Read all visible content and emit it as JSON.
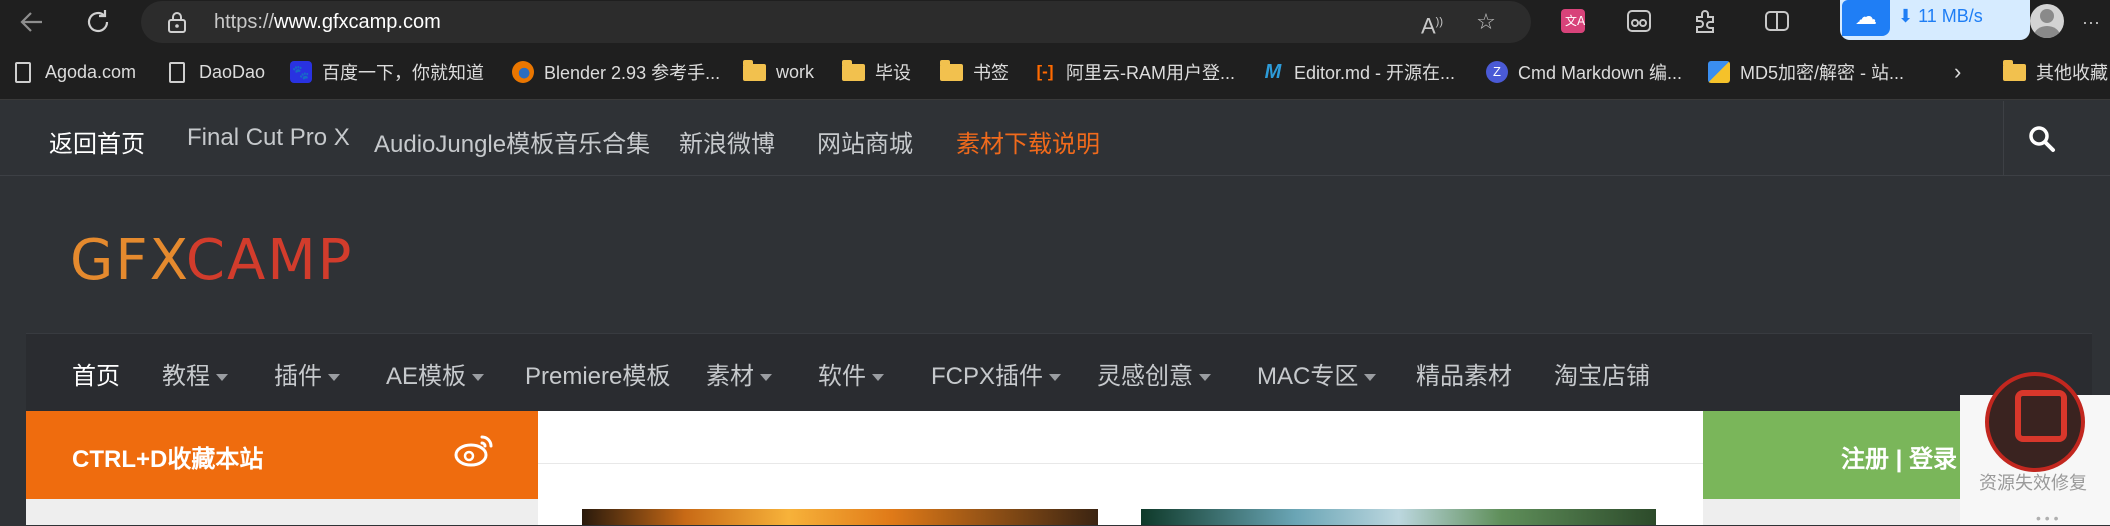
{
  "browser": {
    "url_prefix": "https://",
    "url_domain": "www.gfxcamp.com",
    "download_speed": "11 MB/s",
    "menu_glyph": "···"
  },
  "bookmarks": [
    {
      "label": "Agoda.com",
      "icon": "page-icon"
    },
    {
      "label": "DaoDao",
      "icon": "page-icon"
    },
    {
      "label": "百度一下，你就知道",
      "icon": "baidu-icon"
    },
    {
      "label": "Blender 2.93 参考手...",
      "icon": "blender-icon"
    },
    {
      "label": "work",
      "icon": "folder-icon"
    },
    {
      "label": "毕设",
      "icon": "folder-icon"
    },
    {
      "label": "书签",
      "icon": "folder-icon"
    },
    {
      "label": "阿里云-RAM用户登...",
      "icon": "aliyun-icon"
    },
    {
      "label": "Editor.md - 开源在...",
      "icon": "editormd-icon"
    },
    {
      "label": "Cmd Markdown 编...",
      "icon": "cmd-markdown-icon"
    },
    {
      "label": "MD5加密/解密 - 站...",
      "icon": "md5-icon"
    },
    {
      "label": "其他收藏",
      "icon": "folder-icon"
    }
  ],
  "site_top_nav": [
    {
      "label": "返回首页"
    },
    {
      "label": "Final Cut Pro X"
    },
    {
      "label": "AudioJungle模板音乐合集"
    },
    {
      "label": "新浪微博"
    },
    {
      "label": "网站商城"
    },
    {
      "label": "素材下载说明"
    }
  ],
  "logo": {
    "part1": "GFX",
    "part2": "CAMP"
  },
  "main_nav": [
    {
      "label": "首页"
    },
    {
      "label": "教程"
    },
    {
      "label": "插件"
    },
    {
      "label": "AE模板"
    },
    {
      "label": "Premiere模板"
    },
    {
      "label": "素材"
    },
    {
      "label": "软件"
    },
    {
      "label": "FCPX插件"
    },
    {
      "label": "灵感创意"
    },
    {
      "label": "MAC专区"
    },
    {
      "label": "精品素材"
    },
    {
      "label": "淘宝店铺"
    }
  ],
  "sidebar_left": {
    "bookmark_hint": "CTRL+D收藏本站"
  },
  "sidebar_right": {
    "register": "注册",
    "separator": "|",
    "login": "登录"
  },
  "float_widget": {
    "label": "资源失效修复"
  },
  "colors": {
    "accent_orange": "#ef6c0e",
    "accent_green": "#7ab65a",
    "site_bg": "#2f3236",
    "highlight_link": "#f06a1c"
  }
}
